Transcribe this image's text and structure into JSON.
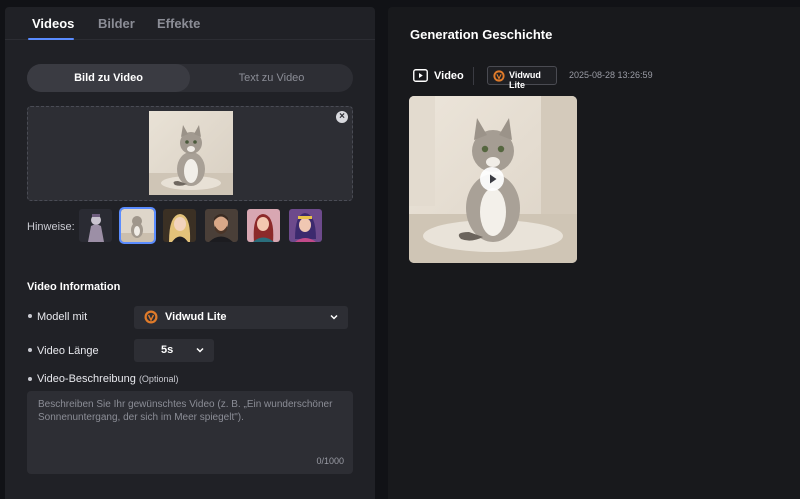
{
  "tabs": [
    {
      "label": "Videos",
      "active": true
    },
    {
      "label": "Bilder",
      "active": false
    },
    {
      "label": "Effekte",
      "active": false
    }
  ],
  "mode_switch": {
    "active": "Bild zu Video",
    "inactive": "Text zu Video"
  },
  "upload": {
    "close_glyph": "×"
  },
  "hints": {
    "label": "Hinweise:",
    "selected_index": 1,
    "count": 6
  },
  "video_info": {
    "title": "Video Information",
    "model": {
      "label": "Modell mit",
      "value": "Vidwud Lite"
    },
    "length": {
      "label": "Video Länge",
      "value": "5s"
    },
    "description": {
      "label": "Video-Beschreibung",
      "optional": "(Optional)",
      "placeholder": "Beschreiben Sie Ihr gewünschtes Video (z. B. „Ein wunderschöner Sonnenuntergang, der sich im Meer spiegelt\").",
      "counter": "0/1000"
    }
  },
  "history": {
    "title": "Generation Geschichte",
    "type_label": "Video",
    "model": "Vidwud Lite",
    "timestamp": "2025-08-28 13:26:59"
  },
  "colors": {
    "accent": "#5a8cff",
    "panel": "#202126",
    "background": "#111216",
    "field": "#2d2e34"
  },
  "icons": [
    "close-icon",
    "chevron-down-icon",
    "video-icon",
    "vidwud-logo-icon",
    "play-icon"
  ]
}
